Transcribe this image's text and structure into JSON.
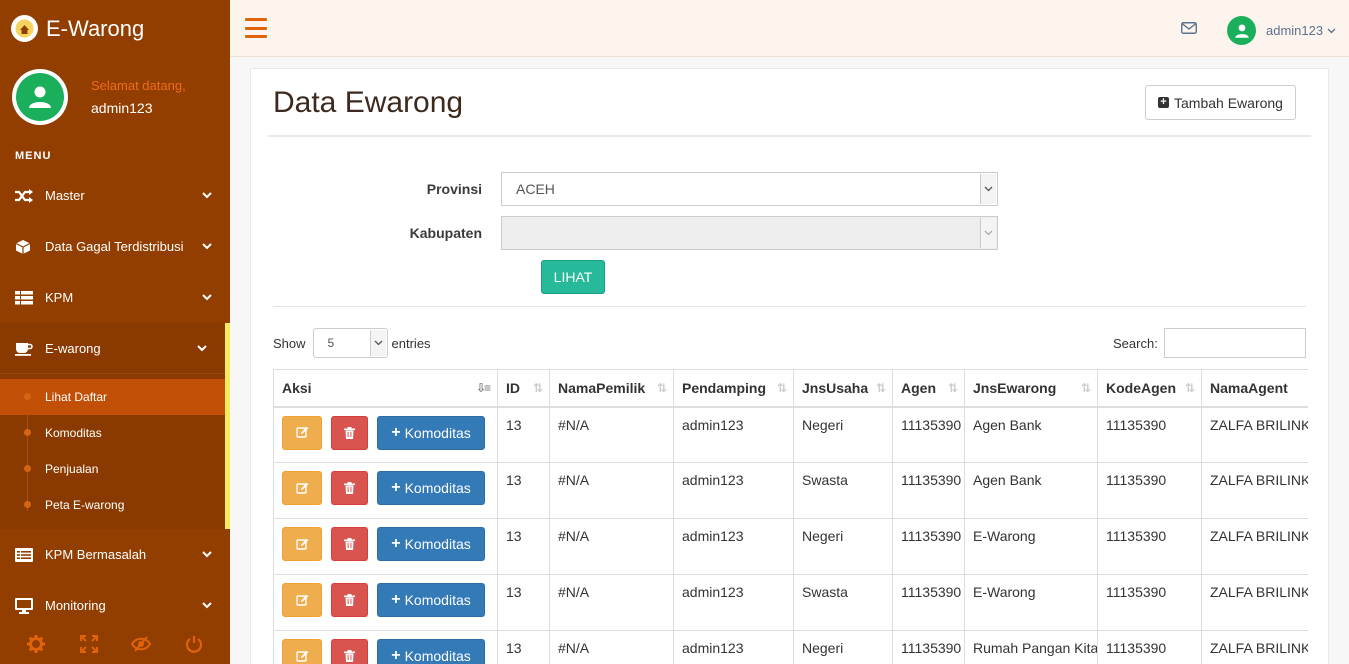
{
  "app": {
    "brand": "E-Warong"
  },
  "profile": {
    "welcome": "Selamat datang,",
    "name": "admin123"
  },
  "menu": {
    "heading": "MENU",
    "items": [
      {
        "label": "Master",
        "icon": "shuffle-icon"
      },
      {
        "label": "Data Gagal Terdistribusi",
        "icon": "cube-icon"
      },
      {
        "label": "KPM",
        "icon": "table-icon"
      },
      {
        "label": "E-warong",
        "icon": "coffee-icon"
      },
      {
        "label": "KPM Bermasalah",
        "icon": "list-icon"
      },
      {
        "label": "Monitoring",
        "icon": "desktop-icon"
      }
    ],
    "submenu": [
      {
        "label": "Lihat Daftar"
      },
      {
        "label": "Komoditas"
      },
      {
        "label": "Penjualan"
      },
      {
        "label": "Peta E-warong"
      }
    ]
  },
  "topnav": {
    "user": "admin123"
  },
  "page": {
    "title": "Data Ewarong",
    "add_button": "Tambah Ewarong"
  },
  "filters": {
    "provinsi_label": "Provinsi",
    "provinsi_value": "ACEH",
    "kabupaten_label": "Kabupaten",
    "kabupaten_value": "",
    "lihat_button": "LIHAT"
  },
  "datatable": {
    "show_label": "Show",
    "page_length": "5",
    "entries_label": "entries",
    "search_label": "Search:",
    "columns": [
      "Aksi",
      "ID",
      "NamaPemilik",
      "Pendamping",
      "JnsUsaha",
      "Agen",
      "JnsEwarong",
      "KodeAgen",
      "NamaAgent"
    ],
    "komoditas_button": "Komoditas",
    "rows": [
      {
        "id": "13",
        "pemilik": "#N/A",
        "pendamping": "admin123",
        "usaha": "Negeri",
        "agen": "11135390",
        "jenis": "Agen Bank",
        "kode": "11135390",
        "nama_agent": "ZALFA BRILINK"
      },
      {
        "id": "13",
        "pemilik": "#N/A",
        "pendamping": "admin123",
        "usaha": "Swasta",
        "agen": "11135390",
        "jenis": "Agen Bank",
        "kode": "11135390",
        "nama_agent": "ZALFA BRILINK"
      },
      {
        "id": "13",
        "pemilik": "#N/A",
        "pendamping": "admin123",
        "usaha": "Negeri",
        "agen": "11135390",
        "jenis": "E-Warong",
        "kode": "11135390",
        "nama_agent": "ZALFA BRILINK"
      },
      {
        "id": "13",
        "pemilik": "#N/A",
        "pendamping": "admin123",
        "usaha": "Swasta",
        "agen": "11135390",
        "jenis": "E-Warong",
        "kode": "11135390",
        "nama_agent": "ZALFA BRILINK"
      },
      {
        "id": "13",
        "pemilik": "#N/A",
        "pendamping": "admin123",
        "usaha": "Negeri",
        "agen": "11135390",
        "jenis": "Rumah Pangan Kita",
        "kode": "11135390",
        "nama_agent": "ZALFA BRILINK"
      }
    ]
  },
  "colors": {
    "sidebar": "#923e00",
    "accent": "#e0630b",
    "highlight": "#f4ec5a",
    "success": "#26b99a",
    "primary": "#337ab7",
    "warning": "#f0ad4e",
    "danger": "#d9534f"
  }
}
